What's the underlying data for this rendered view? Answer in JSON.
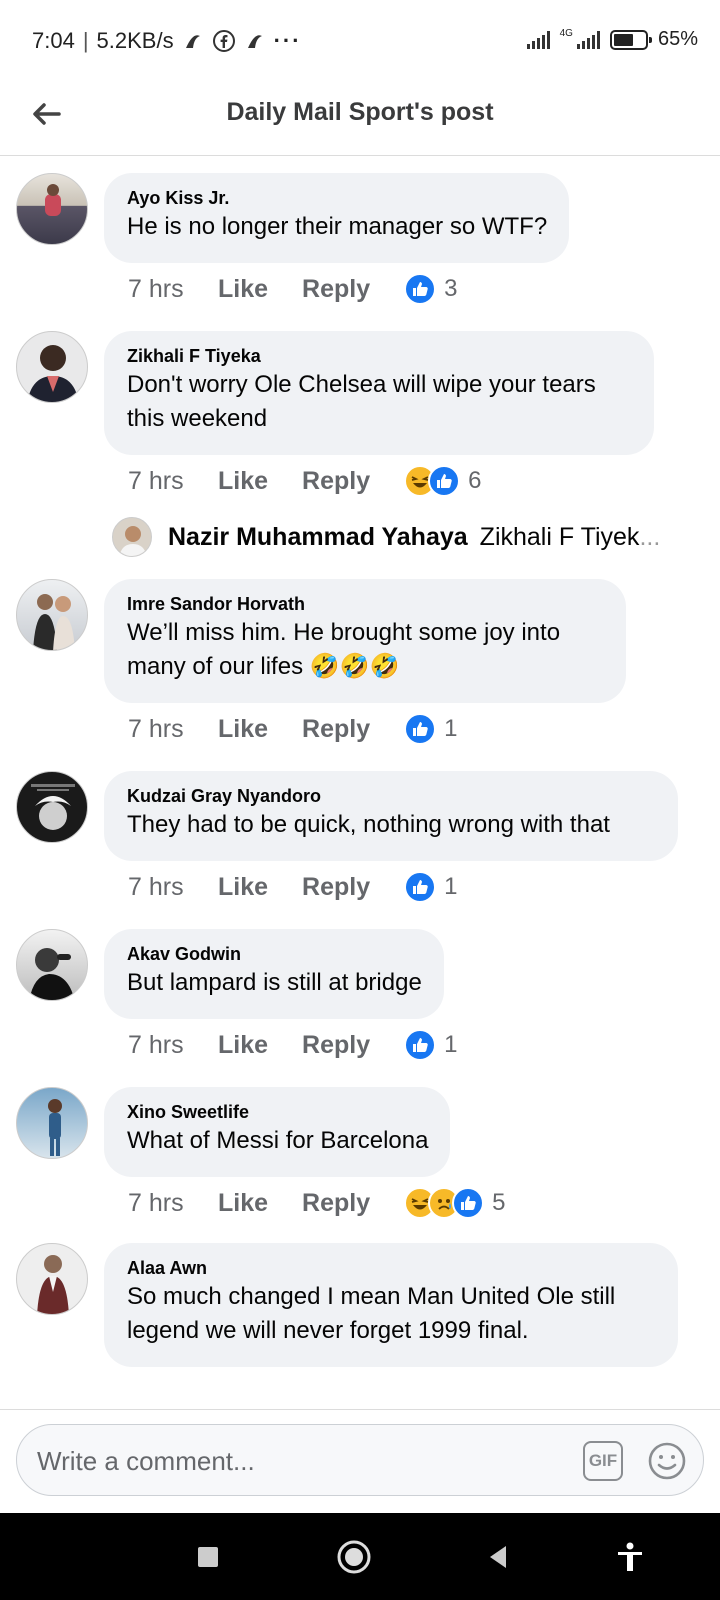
{
  "status_bar": {
    "time": "7:04",
    "network_speed": "5.2KB/s",
    "net_type": "4G",
    "battery": "65%",
    "battery_level": 0.65
  },
  "header": {
    "title": "Daily Mail Sport's post"
  },
  "comments": [
    {
      "author": "Ayo Kiss Jr.",
      "text": "He is no longer their manager so WTF?",
      "time": "7 hrs",
      "like_label": "Like",
      "reply_label": "Reply",
      "reactions": [
        "like"
      ],
      "reaction_count": "3"
    },
    {
      "author": "Zikhali F Tiyeka",
      "text": "Don't worry Ole Chelsea will wipe your tears this weekend",
      "time": "7 hrs",
      "like_label": "Like",
      "reply_label": "Reply",
      "reactions": [
        "haha",
        "like"
      ],
      "reaction_count": "6",
      "reply_preview": {
        "author": "Nazir Muhammad Yahaya",
        "snippet": "Zikhali F Tiyek",
        "ellipsis": "..."
      }
    },
    {
      "author": "Imre Sandor Horvath",
      "text": "We’ll miss him. He brought some joy into many of our lifes 🤣🤣🤣",
      "time": "7 hrs",
      "like_label": "Like",
      "reply_label": "Reply",
      "reactions": [
        "like"
      ],
      "reaction_count": "1"
    },
    {
      "author": "Kudzai Gray Nyandoro",
      "text": "They had to be quick, nothing wrong with that",
      "time": "7 hrs",
      "like_label": "Like",
      "reply_label": "Reply",
      "reactions": [
        "like"
      ],
      "reaction_count": "1"
    },
    {
      "author": "Akav Godwin",
      "text": "But lampard is still at bridge",
      "time": "7 hrs",
      "like_label": "Like",
      "reply_label": "Reply",
      "reactions": [
        "like"
      ],
      "reaction_count": "1"
    },
    {
      "author": "Xino Sweetlife",
      "text": "What of Messi for Barcelona",
      "time": "7 hrs",
      "like_label": "Like",
      "reply_label": "Reply",
      "reactions": [
        "haha",
        "sad",
        "like"
      ],
      "reaction_count": "5"
    },
    {
      "author": "Alaa Awn",
      "text": "So much changed I mean Man United Ole still legend we will never forget 1999 final.",
      "time": "",
      "like_label": "",
      "reply_label": "",
      "reactions": [],
      "reaction_count": ""
    }
  ],
  "composer": {
    "placeholder": "Write a comment...",
    "gif_label": "GIF"
  },
  "icons": {
    "back": "back-arrow-icon",
    "gif": "gif-icon",
    "emoji": "emoji-icon",
    "like": "like-reaction-icon",
    "haha": "haha-reaction-icon",
    "sad": "sad-reaction-icon",
    "nav_recent": "square-icon",
    "nav_home": "circle-icon",
    "nav_back": "triangle-back-icon",
    "nav_accessibility": "accessibility-icon"
  },
  "colors": {
    "facebook_blue": "#1877f2",
    "bubble_bg": "#f0f2f5",
    "meta_gray": "#65676b",
    "haha_yellow": "#f7b928"
  }
}
